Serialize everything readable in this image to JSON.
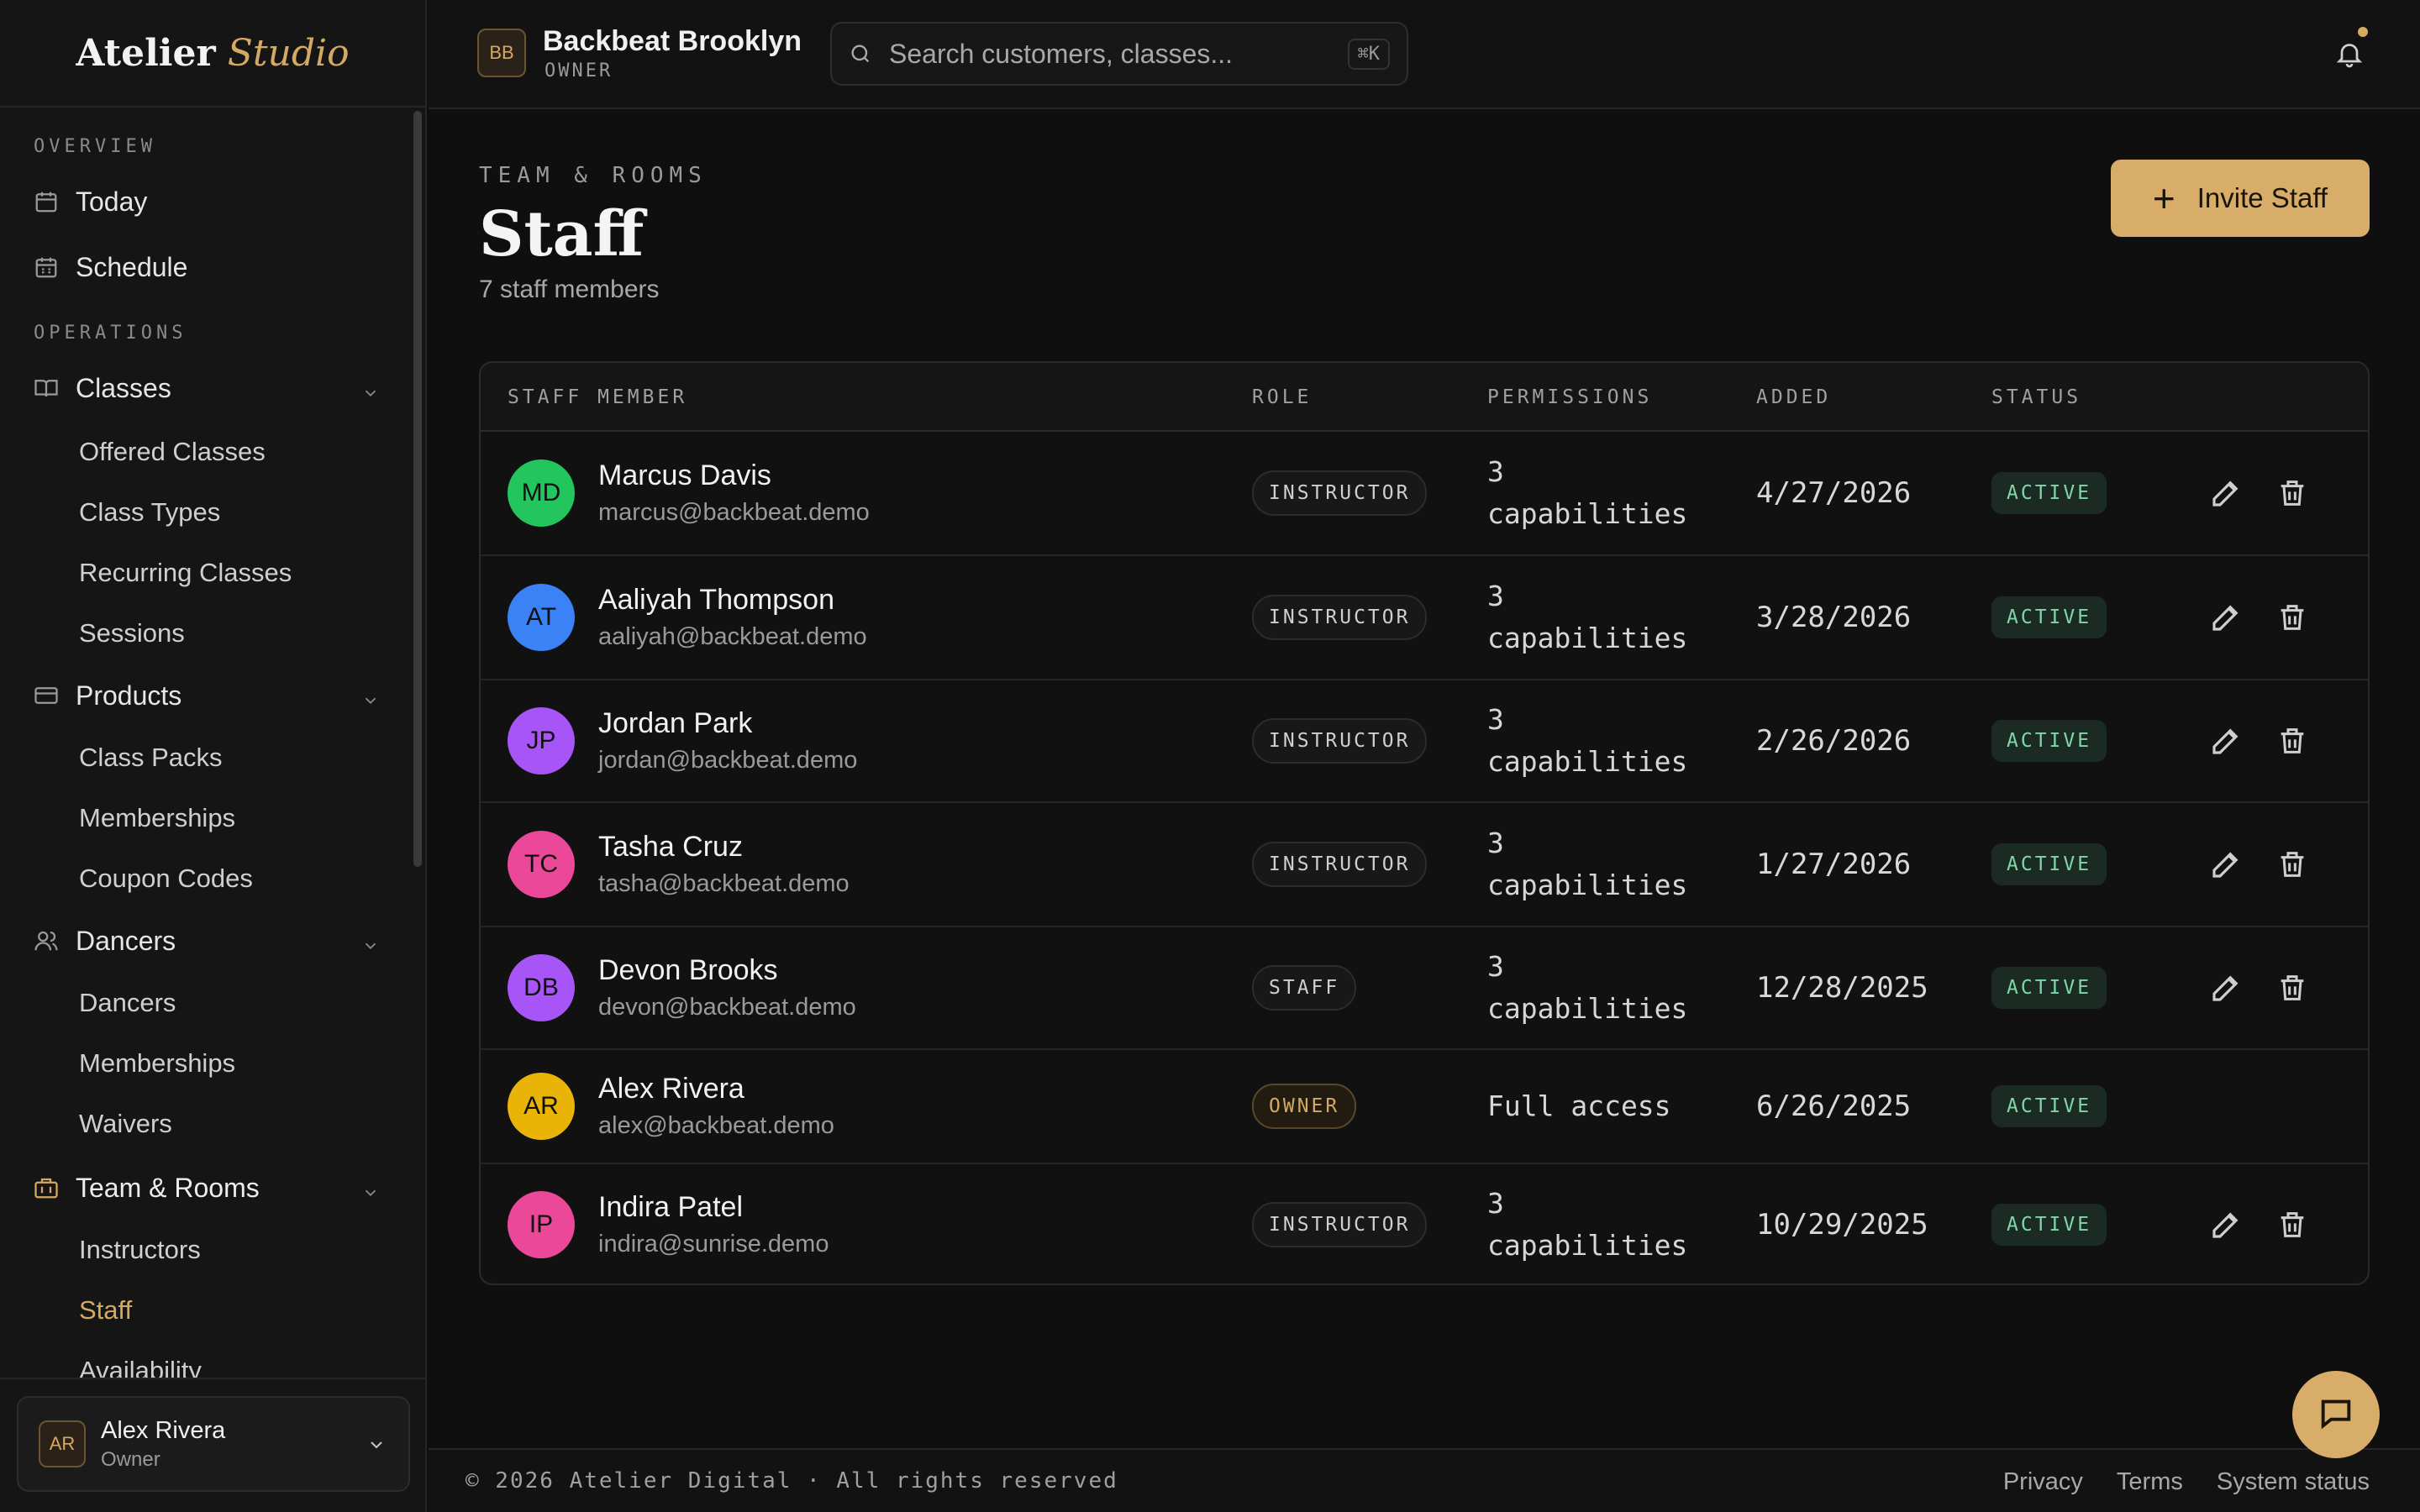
{
  "brand": {
    "word1": "Atelier",
    "word2": "Studio",
    "accent_color": "#d6a962"
  },
  "sidebar": {
    "sections": [
      {
        "label": "OVERVIEW"
      },
      {
        "label": "OPERATIONS"
      }
    ],
    "items": [
      {
        "label": "Today",
        "icon": "calendar-icon"
      },
      {
        "label": "Schedule",
        "icon": "calendar-grid-icon"
      },
      {
        "label": "Classes",
        "icon": "book-icon"
      },
      {
        "label": "Products",
        "icon": "card-icon"
      },
      {
        "label": "Dancers",
        "icon": "users-icon"
      },
      {
        "label": "Team & Rooms",
        "icon": "building-icon"
      }
    ],
    "classes_sub": [
      "Offered Classes",
      "Class Types",
      "Recurring Classes",
      "Sessions"
    ],
    "products_sub": [
      "Class Packs",
      "Memberships",
      "Coupon Codes"
    ],
    "dancers_sub": [
      "Dancers",
      "Memberships",
      "Waivers"
    ],
    "team_sub": [
      "Instructors",
      "Staff",
      "Availability"
    ],
    "user": {
      "initials": "AR",
      "name": "Alex Rivera",
      "role": "Owner"
    }
  },
  "topbar": {
    "org_initials": "BB",
    "org_name": "Backbeat Brooklyn",
    "org_role": "OWNER",
    "search_placeholder": "Search customers, classes...",
    "search_shortcut": "⌘K"
  },
  "page": {
    "eyebrow": "TEAM & ROOMS",
    "title": "Staff",
    "count": "7 staff members",
    "invite_label": "Invite Staff"
  },
  "table": {
    "headers": [
      "STAFF MEMBER",
      "ROLE",
      "PERMISSIONS",
      "ADDED",
      "STATUS"
    ],
    "rows": [
      {
        "initials": "MD",
        "color": "#22c55e",
        "name": "Marcus Davis",
        "email": "marcus@backbeat.demo",
        "role": "INSTRUCTOR",
        "perm1": "3",
        "perm2": "capabilities",
        "added": "4/27/2026",
        "status": "ACTIVE"
      },
      {
        "initials": "AT",
        "color": "#3b82f6",
        "name": "Aaliyah Thompson",
        "email": "aaliyah@backbeat.demo",
        "role": "INSTRUCTOR",
        "perm1": "3",
        "perm2": "capabilities",
        "added": "3/28/2026",
        "status": "ACTIVE"
      },
      {
        "initials": "JP",
        "color": "#a855f7",
        "name": "Jordan Park",
        "email": "jordan@backbeat.demo",
        "role": "INSTRUCTOR",
        "perm1": "3",
        "perm2": "capabilities",
        "added": "2/26/2026",
        "status": "ACTIVE"
      },
      {
        "initials": "TC",
        "color": "#ec4899",
        "name": "Tasha Cruz",
        "email": "tasha@backbeat.demo",
        "role": "INSTRUCTOR",
        "perm1": "3",
        "perm2": "capabilities",
        "added": "1/27/2026",
        "status": "ACTIVE"
      },
      {
        "initials": "DB",
        "color": "#a855f7",
        "name": "Devon Brooks",
        "email": "devon@backbeat.demo",
        "role": "STAFF",
        "perm1": "3",
        "perm2": "capabilities",
        "added": "12/28/2025",
        "status": "ACTIVE"
      },
      {
        "initials": "AR",
        "color": "#eab308",
        "name": "Alex Rivera",
        "email": "alex@backbeat.demo",
        "role": "OWNER",
        "perm1": "Full access",
        "perm2": "",
        "added": "6/26/2025",
        "status": "ACTIVE"
      },
      {
        "initials": "IP",
        "color": "#ec4899",
        "name": "Indira Patel",
        "email": "indira@sunrise.demo",
        "role": "INSTRUCTOR",
        "perm1": "3",
        "perm2": "capabilities",
        "added": "10/29/2025",
        "status": "ACTIVE"
      }
    ]
  },
  "footer": {
    "copyright": "© 2026 Atelier Digital · All rights reserved",
    "links": [
      "Privacy",
      "Terms",
      "System status"
    ]
  }
}
